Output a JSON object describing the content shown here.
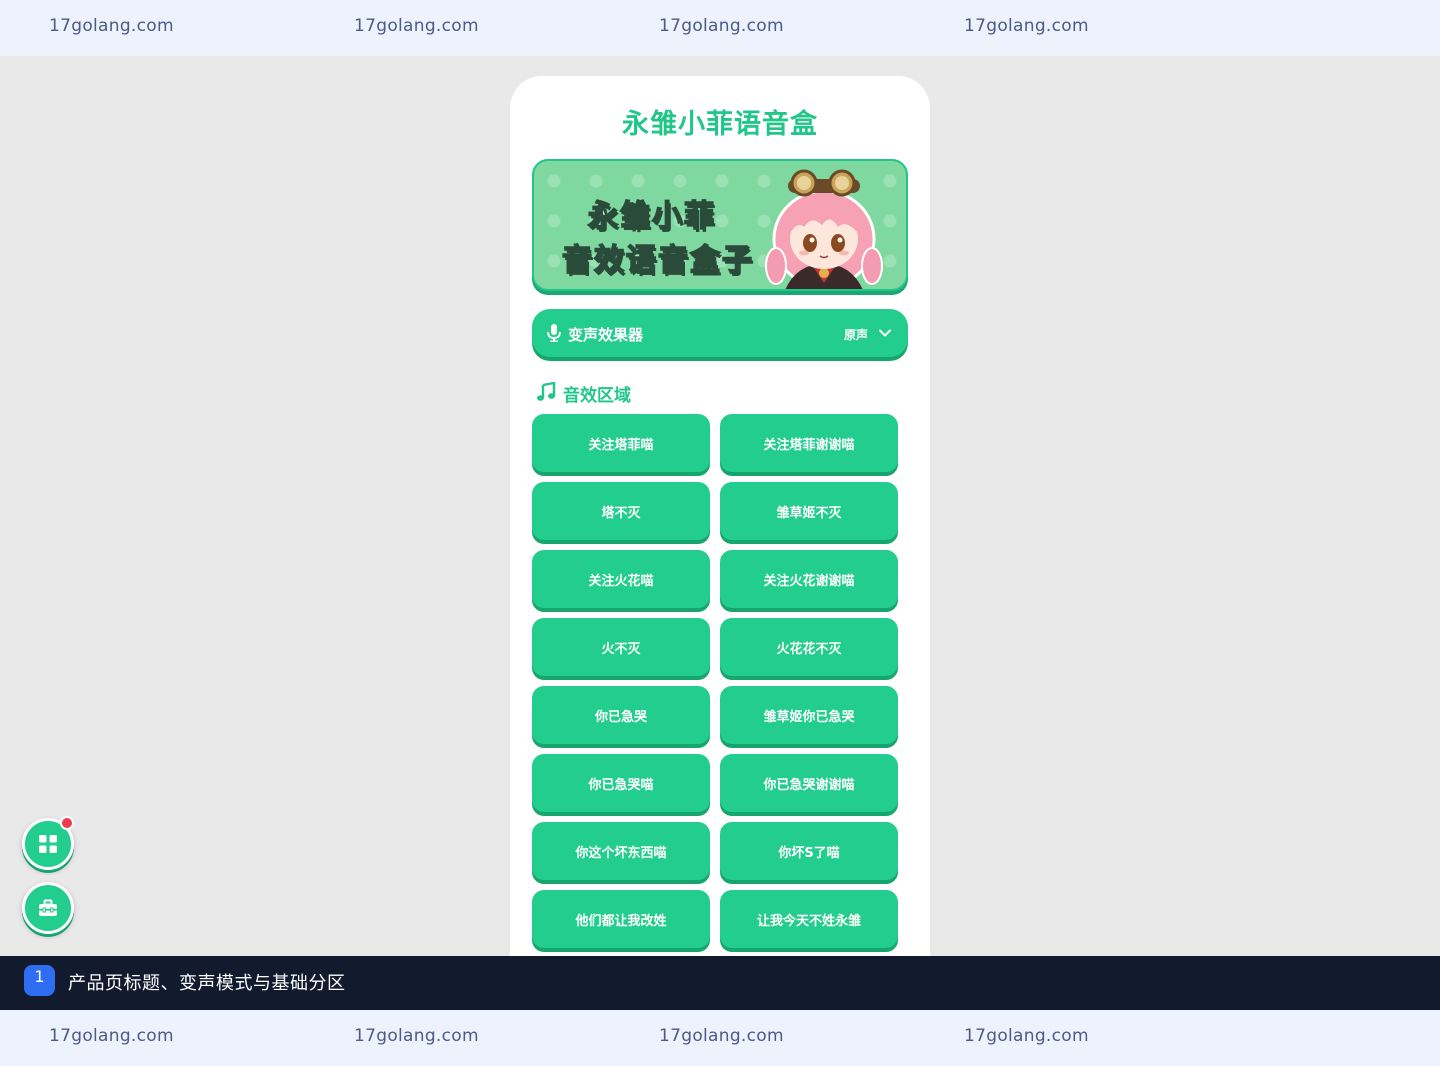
{
  "watermark": {
    "text": "17golang.com"
  },
  "app": {
    "title": "永雏小菲语音盒"
  },
  "banner": {
    "line1": "永雏小菲",
    "line2": "音效语音盒子"
  },
  "voice_changer": {
    "label": "变声效果器",
    "mode": "原声",
    "icon": "microphone-icon"
  },
  "sound_section": {
    "title": "音效区域",
    "icon": "music-note-icon"
  },
  "sound_buttons": [
    "关注塔菲喵",
    "关注塔菲谢谢喵",
    "塔不灭",
    "雏草姬不灭",
    "关注火花喵",
    "关注火花谢谢喵",
    "火不灭",
    "火花花不灭",
    "你已急哭",
    "雏草姬你已急哭",
    "你已急哭喵",
    "你已急哭谢谢喵",
    "你这个坏东西喵",
    "你坏S了喵",
    "他们都让我改姓",
    "让我今天不姓永雏"
  ],
  "fabs": [
    {
      "icon": "grid-icon",
      "badge": true
    },
    {
      "icon": "toolbox-icon",
      "badge": false
    }
  ],
  "caption": {
    "number": "1",
    "text": "产品页标题、变声模式与基础分区"
  },
  "colors": {
    "accent": "#22cd8d",
    "accent_dark": "#17a56f",
    "badge": "#ef3a4c",
    "caption_bg": "#121a2e",
    "caption_num": "#2f6df2"
  }
}
